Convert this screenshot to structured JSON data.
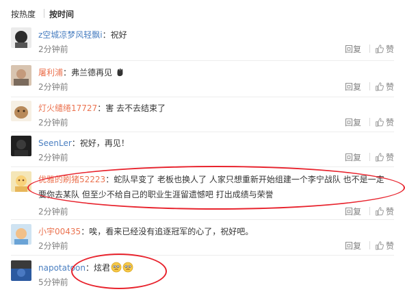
{
  "sort": {
    "hot_label": "按热度",
    "time_label": "按时间"
  },
  "actions": {
    "reply_label": "回复",
    "like_label": "赞"
  },
  "comments": [
    {
      "user": "z空城凉梦风轻飘i",
      "text": "：祝好",
      "time": "2分钟前"
    },
    {
      "user": "屠利浦",
      "text": "：弗兰德再见",
      "time": "2分钟前"
    },
    {
      "user": "灯火缱绻17727",
      "text": "：害 去不去结束了",
      "time": "2分钟前"
    },
    {
      "user": "SeenLer",
      "text": "：祝好，再见！",
      "time": "2分钟前"
    },
    {
      "user": "优雅的刷猪52223",
      "text": "：蛇队早变了 老板也换人了 人家只想重新开始组建一个李宁战队 也不是一定要你去某队 但至少不给自己的职业生涯留遗憾吧 打出成绩与荣誉",
      "time": "2分钟前"
    },
    {
      "user": "小宇00435",
      "text": "：唉，看来已经没有追逐冠军的心了，祝好吧。",
      "time": "2分钟前"
    },
    {
      "user": "napotatoon",
      "text": "：炫君",
      "time": "5分钟前"
    }
  ],
  "colors": {
    "username": "#eb7350",
    "annotation": "#e8232d"
  }
}
